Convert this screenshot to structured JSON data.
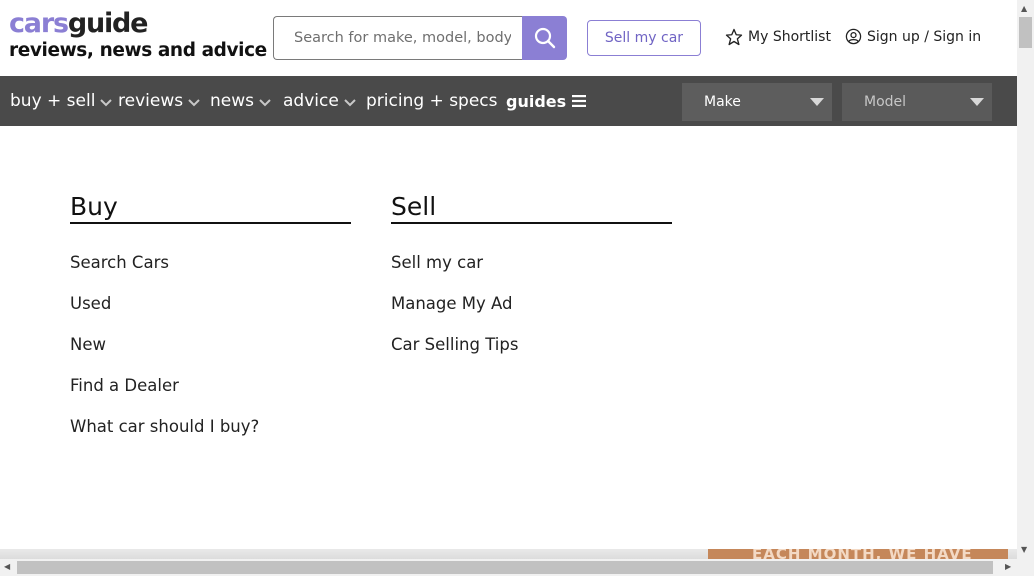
{
  "header": {
    "logo": {
      "part1": "cars",
      "part2": "guide",
      "tagline": "reviews, news and advice"
    },
    "search": {
      "placeholder": "Search for make, model, body type"
    },
    "sell_button": "Sell my car",
    "shortlist": "My Shortlist",
    "signin": "Sign up / Sign in"
  },
  "nav": {
    "items": [
      {
        "label": "buy + sell"
      },
      {
        "label": "reviews"
      },
      {
        "label": "news"
      },
      {
        "label": "advice"
      },
      {
        "label": "pricing + specs"
      },
      {
        "label": "guides"
      }
    ],
    "make_select": "Make",
    "model_select": "Model"
  },
  "mega_menu": {
    "buy": {
      "title": "Buy",
      "links": [
        "Search Cars",
        "Used",
        "New",
        "Find a Dealer",
        "What car should I buy?"
      ]
    },
    "sell": {
      "title": "Sell",
      "links": [
        "Sell my car",
        "Manage My Ad",
        "Car Selling Tips"
      ]
    }
  },
  "promo_banner": "EACH MONTH, WE HAVE",
  "colors": {
    "brand_purple": "#8b7fd4",
    "nav_bg": "#4a4a4a",
    "select_bg": "#5d5d5d"
  }
}
